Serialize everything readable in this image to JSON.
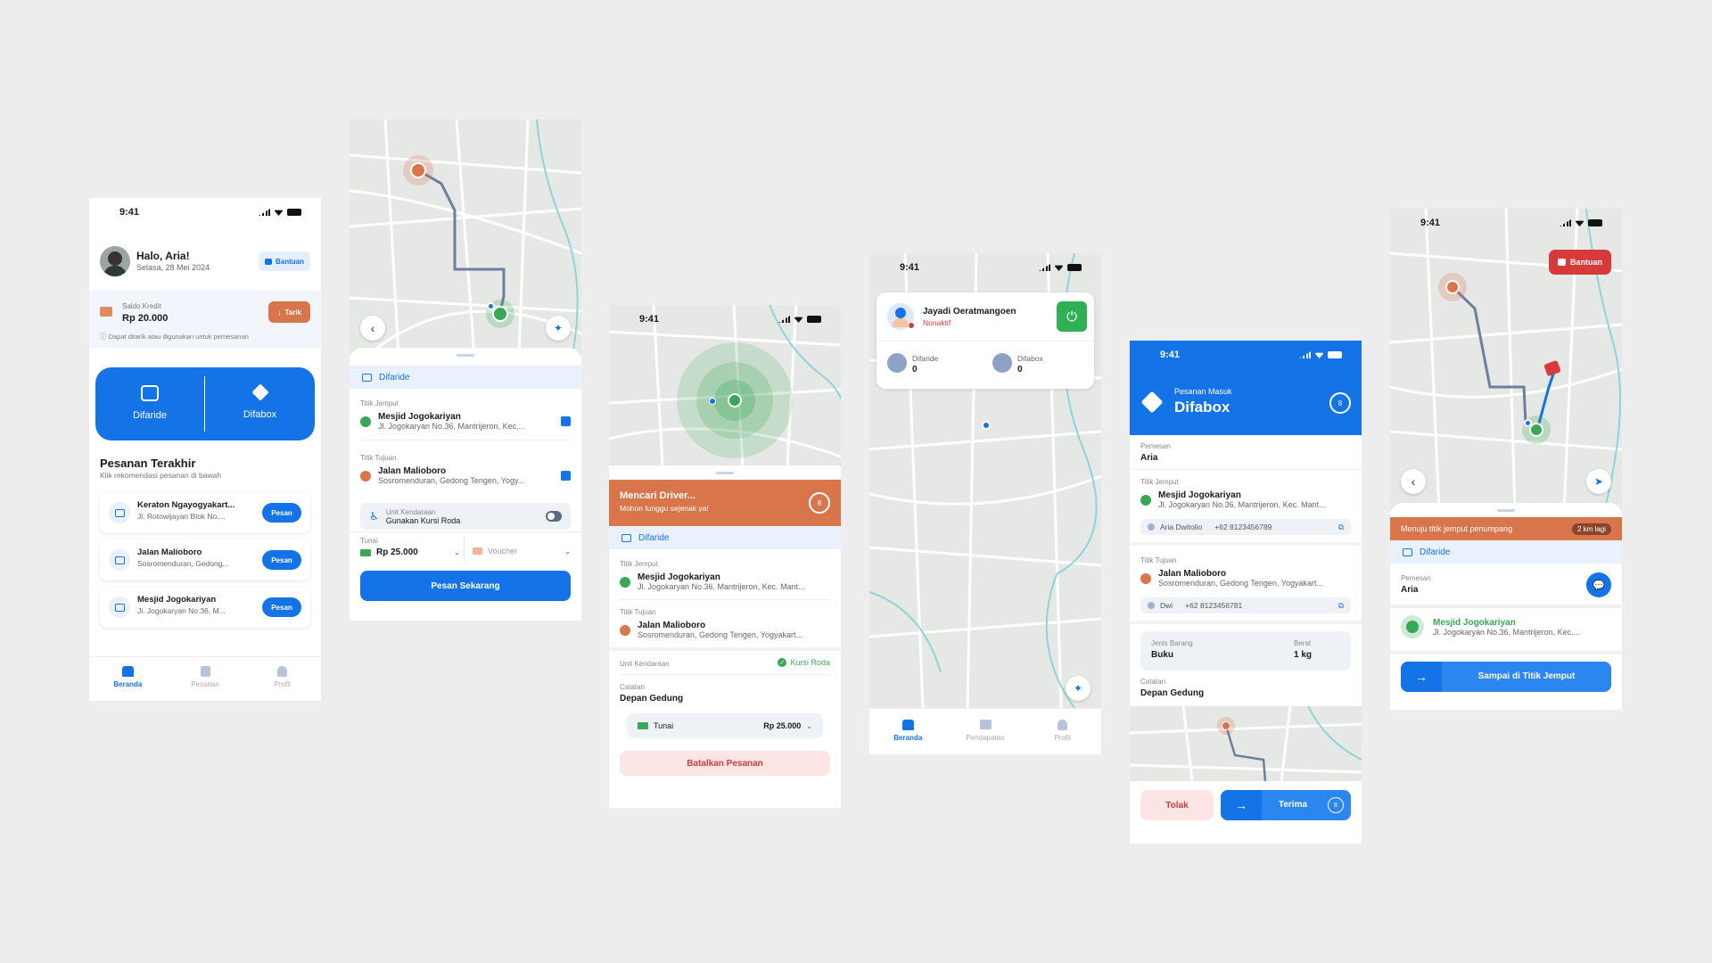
{
  "status_time": "9:41",
  "s1": {
    "greeting": "Halo, Aria!",
    "date": "Selasa, 28 Mei 2024",
    "help": "Bantuan",
    "credit_label": "Saldo Kredit",
    "credit_value": "Rp 20.000",
    "withdraw": "Tarik",
    "credit_note": "Dapat ditarik atau digunakan untuk pemesanan",
    "svc_ride": "Difaride",
    "svc_box": "Difabox",
    "recent_title": "Pesanan Terakhir",
    "recent_sub": "Klik rekomendasi pesanan di bawah",
    "orders": [
      {
        "title": "Keraton Ngayogyakart...",
        "addr": "Jl. Rotowijayan Blok No....",
        "btn": "Pesan"
      },
      {
        "title": "Jalan Malioboro",
        "addr": "Sosromenduran, Gedong...",
        "btn": "Pesan"
      },
      {
        "title": "Mesjid Jogokariyan",
        "addr": "Jl. Jogokaryan No.36, M...",
        "btn": "Pesan"
      }
    ],
    "nav": [
      "Beranda",
      "Pesanan",
      "Profil"
    ]
  },
  "s2": {
    "service": "Difaride",
    "pickup_label": "Titik Jemput",
    "pickup_title": "Mesjid Jogokariyan",
    "pickup_addr": "Jl. Jogokaryan No.36, Mantrijeron, Kec....",
    "dest_label": "Titik Tujuan",
    "dest_title": "Jalan Malioboro",
    "dest_addr": "Sosromenduran, Gedong Tengen, Yogy...",
    "unit_label": "Unit Kendaraan",
    "unit_value": "Gunakan Kursi Roda",
    "pay_label": "Tunai",
    "pay_value": "Rp 25.000",
    "voucher": "Voucher",
    "cta": "Pesan Sekarang"
  },
  "s3": {
    "banner_title": "Mencari Driver...",
    "banner_sub": "Mohon tunggu sejenak ya!",
    "timer": "8",
    "service": "Difaride",
    "pickup_label": "Titik Jemput",
    "pickup_title": "Mesjid Jogokariyan",
    "pickup_addr": "Jl. Jogokaryan No.36, Mantrijeron, Kec. Mant...",
    "dest_label": "Titik Tujuan",
    "dest_title": "Jalan Malioboro",
    "dest_addr": "Sosromenduran, Gedong Tengen, Yogyakart...",
    "unit_label": "Unit Kendaraan",
    "unit_value": "Kursi Roda",
    "note_label": "Catatan",
    "note_value": "Depan Gedung",
    "pay_label": "Tunai",
    "pay_value": "Rp 25.000",
    "cancel": "Batalkan Pesanan"
  },
  "s4": {
    "driver_name": "Jayadi Oeratmangoen",
    "driver_status": "Nonaktif",
    "ride_label": "Difaride",
    "ride_count": "0",
    "box_label": "Difabox",
    "box_count": "0",
    "nav": [
      "Beranda",
      "Pendapatan",
      "Profil"
    ]
  },
  "s5": {
    "header_sub": "Pesanan Masuk",
    "header_title": "Difabox",
    "timer": "8",
    "orderer_label": "Pemesan",
    "orderer": "Aria",
    "pickup_label": "Titik Jemput",
    "pickup_title": "Mesjid Jogokariyan",
    "pickup_addr": "Jl. Jogokaryan No.36, Mantrijeron, Kec. Mant...",
    "pickup_contact": "Aria Dwitolio",
    "pickup_phone": "+62 8123456789",
    "dest_label": "Titik Tujuan",
    "dest_title": "Jalan Malioboro",
    "dest_addr": "Sosromenduran, Gedong Tengen, Yogyakart...",
    "dest_contact": "Dwi",
    "dest_phone": "+62 8123456781",
    "item_label": "Jenis Barang",
    "item_value": "Buku",
    "weight_label": "Berat",
    "weight_value": "1 kg",
    "note_label": "Catatan",
    "note_value": "Depan Gedung",
    "reject": "Tolak",
    "accept": "Terima",
    "accept_timer": "8"
  },
  "s6": {
    "help": "Bantuan",
    "banner": "Menuju titik jemput penumpang",
    "distance": "2 km lagi",
    "service": "Difaride",
    "orderer_label": "Pemesan",
    "orderer": "Aria",
    "pickup_title": "Mesjid Jogokariyan",
    "pickup_addr": "Jl. Jogokaryan No.36, Mantrijeron, Kec....",
    "cta": "Sampai di Titik Jemput"
  },
  "colors": {
    "primary": "#1473e6",
    "orange": "#d9754a",
    "green": "#3aa757",
    "danger": "#d63a3a"
  }
}
